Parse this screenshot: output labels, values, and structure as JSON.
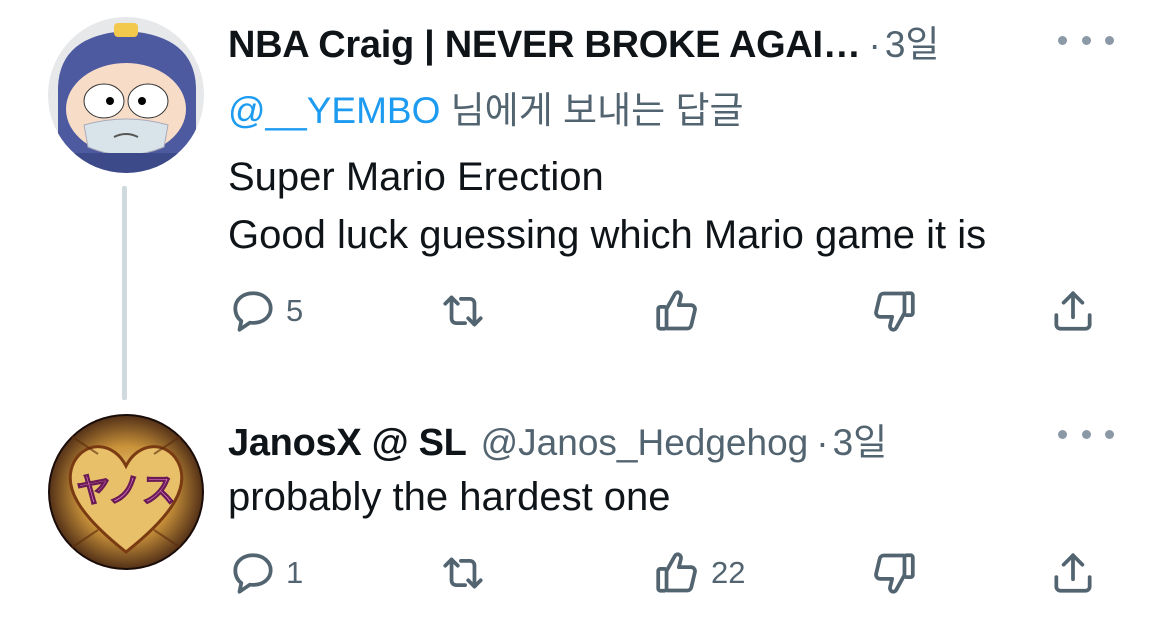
{
  "tweets": [
    {
      "display_name": "NBA Craig | NEVER BROKE AGAI…",
      "dot": "·",
      "time": "3일",
      "reply_to": {
        "mention": "@__YEMBO",
        "suffix": " 님에게 보내는 답글"
      },
      "text_lines": [
        "Super Mario Erection",
        "Good luck guessing which Mario game it is"
      ],
      "actions": {
        "reply_count": "5",
        "retweet_count": "",
        "like_count": "",
        "dislike_count": ""
      }
    },
    {
      "display_name": "JanosX @ SL",
      "handle": "@Janos_Hedgehog",
      "dot": "·",
      "time": "3일",
      "text_lines": [
        "probably the hardest one"
      ],
      "avatar_text": "ヤノス",
      "actions": {
        "reply_count": "1",
        "retweet_count": "",
        "like_count": "22",
        "dislike_count": ""
      }
    }
  ],
  "icons": [
    "more-options-icon",
    "reply-icon",
    "retweet-icon",
    "like-icon",
    "dislike-icon",
    "share-icon"
  ],
  "colors": {
    "link": "#1d9bf0",
    "secondary_text": "#536471",
    "thread_line": "#cfd9de"
  }
}
